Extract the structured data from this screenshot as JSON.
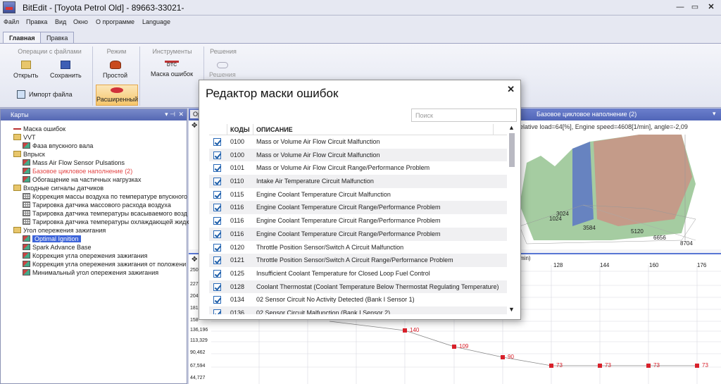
{
  "window": {
    "title": "BitEdit - [Toyota Petrol Old] - 89663-33021-"
  },
  "menu": [
    "Файл",
    "Правка",
    "Вид",
    "Окно",
    "О программе",
    "Language"
  ],
  "ribbon_tabs": [
    "Главная",
    "Правка"
  ],
  "ribbon": {
    "groups": [
      "Операции с файлами",
      "Режим",
      "Инструменты",
      "Решения"
    ],
    "open": "Открыть",
    "save": "Сохранить",
    "import": "Импорт файла",
    "simple": "Простой",
    "advanced": "Расширенный",
    "dtc_icon": "DTC",
    "mask": "Маска ошибок",
    "solutions_btn": "Решения"
  },
  "panel": {
    "title": "Карты",
    "tree": [
      {
        "label": "Маска ошибок"
      },
      {
        "label": "VVT"
      },
      {
        "label": "Фаза впускного вала"
      },
      {
        "label": "Впрыск"
      },
      {
        "label": "Mass Air Flow Sensor Pulsations"
      },
      {
        "label": "Базовое цикловое наполнение (2)"
      },
      {
        "label": "Обогащение на частичных нагрузках"
      },
      {
        "label": "Входные сигналы датчиков"
      },
      {
        "label": "Коррекция массы воздуха по температуре впускного"
      },
      {
        "label": "Тарировка датчика массового расхода воздуха"
      },
      {
        "label": "Тарировка датчика температуры всасываемого возд"
      },
      {
        "label": "Тарировка датчика температуры охлаждающей жидк"
      },
      {
        "label": "Угол опережения зажигания"
      },
      {
        "label": "Optimal Ignition"
      },
      {
        "label": "Spark Advance Base"
      },
      {
        "label": "Коррекция угла опережения зажигания"
      },
      {
        "label": "Коррекция угла опережения зажигания от положени"
      },
      {
        "label": "Минимальный угол опережения зажигания"
      }
    ]
  },
  "right": {
    "tab_left": "Op",
    "tab_active": "Базовое цикловое наполнение (2)",
    "chart3d_info": "elative load=64[%], Engine speed=4608[1/min], angle=-2,09",
    "chart3d_labels": [
      "3024",
      "1024",
      "3584",
      "5120",
      "6656",
      "8704"
    ],
    "chart2d_unit": "min)",
    "x_ticks": [
      "128",
      "144",
      "160",
      "176"
    ],
    "y_ticks": [
      "250",
      "227",
      "204",
      "181",
      "158",
      "136,196",
      "113,329",
      "90,462",
      "67,594",
      "44,727"
    ],
    "point_labels": [
      "140",
      "109",
      "90",
      "73",
      "73",
      "73",
      "73"
    ]
  },
  "modal": {
    "title": "Редактор маски ошибок",
    "close": "✕",
    "search_placeholder": "Поиск",
    "col_codes": "КОДЫ",
    "col_desc": "ОПИСАНИЕ",
    "rows": [
      {
        "code": "0100",
        "desc": "Mass or Volume Air Flow Circuit Malfunction"
      },
      {
        "code": "0100",
        "desc": "Mass or Volume Air Flow Circuit Malfunction"
      },
      {
        "code": "0101",
        "desc": "Mass or Volume Air Flow Circuit Range/Performance Problem"
      },
      {
        "code": "0110",
        "desc": "Intake Air Temperature Circuit Malfunction"
      },
      {
        "code": "0115",
        "desc": "Engine Coolant Temperature Circuit Malfunction"
      },
      {
        "code": "0116",
        "desc": "Engine Coolant Temperature Circuit Range/Performance Problem"
      },
      {
        "code": "0116",
        "desc": "Engine Coolant Temperature Circuit Range/Performance Problem"
      },
      {
        "code": "0116",
        "desc": "Engine Coolant Temperature Circuit Range/Performance Problem"
      },
      {
        "code": "0120",
        "desc": "Throttle Position Sensor/Switch A Circuit Malfunction"
      },
      {
        "code": "0121",
        "desc": "Throttle Position Sensor/Switch A Circuit Range/Performance Problem"
      },
      {
        "code": "0125",
        "desc": "Insufficient Coolant Temperature for Closed Loop Fuel Control"
      },
      {
        "code": "0128",
        "desc": "Coolant Thermostat (Coolant Temperature Below Thermostat Regulating Temperature)"
      },
      {
        "code": "0134",
        "desc": "02 Sensor Circuit No Activity Detected (Bank I Sensor 1)"
      },
      {
        "code": "0136",
        "desc": "02 Sensor Circuit Malfunction (Bank I Sensor 2)"
      }
    ]
  }
}
